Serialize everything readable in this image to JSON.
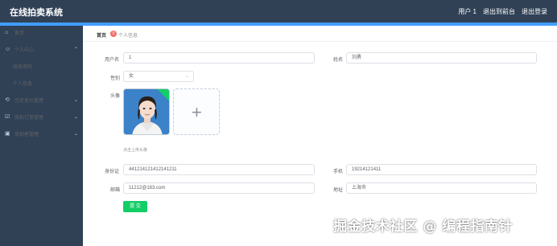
{
  "app": {
    "title": "在线拍卖系统"
  },
  "header": {
    "user_label": "用户 1",
    "backend_label": "退出到前台",
    "logout_label": "退出登录"
  },
  "sidebar": {
    "items": [
      {
        "label": "首页",
        "icon": "home-icon"
      },
      {
        "label": "个人中心",
        "icon": "user-icon"
      },
      {
        "label": "修改密码",
        "icon": ""
      },
      {
        "label": "个人信息",
        "icon": ""
      },
      {
        "label": "历史竞价管理",
        "icon": "history-icon"
      },
      {
        "label": "竞拍订单管理",
        "icon": "order-icon"
      },
      {
        "label": "竞拍者管理",
        "icon": "bidder-icon"
      }
    ]
  },
  "breadcrumb": {
    "home": "首页",
    "badge": "0",
    "current": "个人信息"
  },
  "form": {
    "username_label": "用户名",
    "username_value": "1",
    "name_label": "姓名",
    "name_value": "刘勇",
    "gender_label": "性别",
    "gender_value": "女",
    "avatar_label": "头像",
    "upload_tip": "点击上传头像",
    "idcard_label": "身份证",
    "idcard_value": "441214121412141211",
    "phone_label": "手机",
    "phone_value": "19214121411",
    "email_label": "邮箱",
    "email_value": "11212@163.com",
    "address_label": "地址",
    "address_value": "上海市",
    "submit_label": "提 交"
  },
  "watermark": "掘金技术社区 @ 编程指南针",
  "colors": {
    "sidebar_bg": "#304156",
    "accent": "#409eff",
    "submit": "#13ce66"
  }
}
